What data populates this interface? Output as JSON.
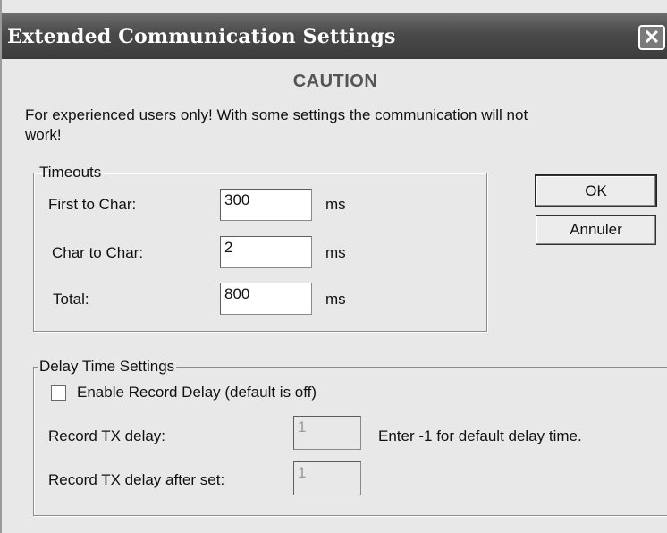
{
  "window": {
    "title": "Extended Communication Settings",
    "close_glyph": "✕"
  },
  "caution": "CAUTION",
  "warning_line1": "For experienced users only! With some settings the communication will not",
  "warning_line2": "work!",
  "timeouts": {
    "legend": "Timeouts",
    "rows": [
      {
        "label": "First to Char:",
        "value": "300",
        "unit": "ms"
      },
      {
        "label": "Char to Char:",
        "value": "2",
        "unit": "ms"
      },
      {
        "label": "Total:",
        "value": "800",
        "unit": "ms"
      }
    ]
  },
  "buttons": {
    "ok": "OK",
    "cancel": "Annuler"
  },
  "delay": {
    "legend": "Delay Time Settings",
    "checkbox_label": "Enable Record Delay (default is off)",
    "checkbox_checked": false,
    "tx_delay_label": "Record TX delay:",
    "tx_delay_value": "1",
    "tx_delay_hint": "Enter -1 for default delay time.",
    "tx_delay_after_label": "Record TX delay after set:",
    "tx_delay_after_value": "1"
  }
}
